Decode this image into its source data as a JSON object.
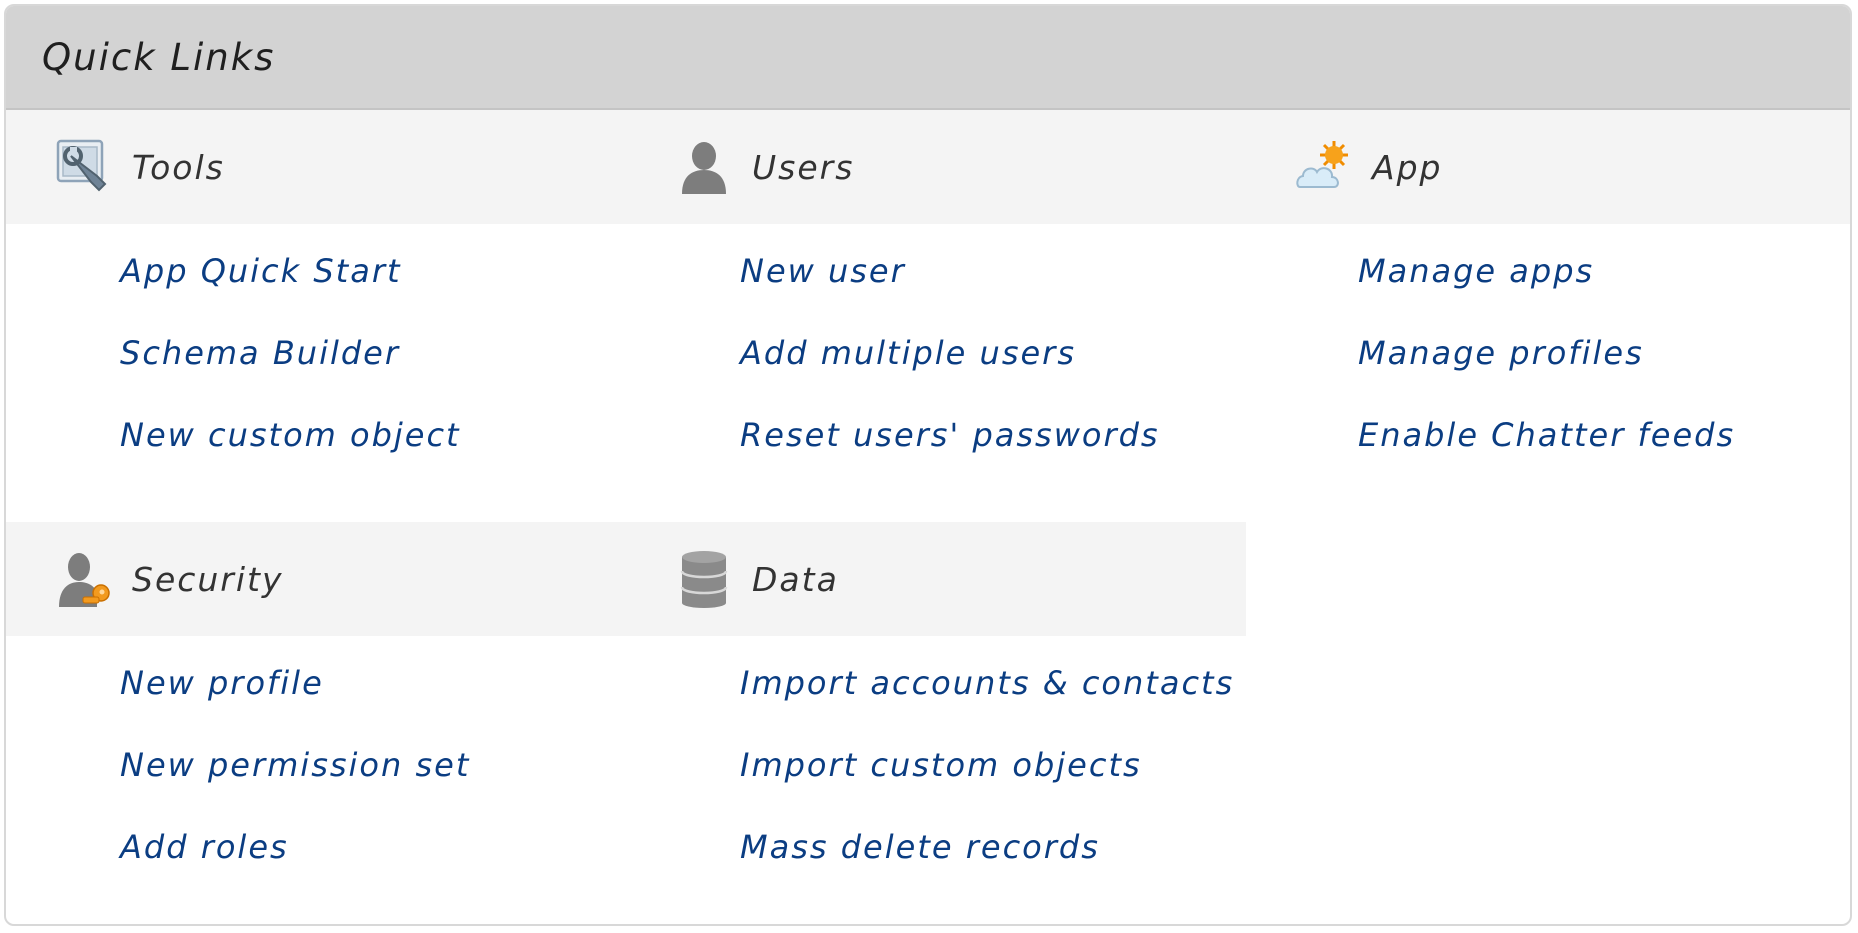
{
  "panel": {
    "title": "Quick Links"
  },
  "sections": {
    "tools": {
      "label": "Tools",
      "icon": "tools-icon",
      "links": [
        "App Quick Start",
        "Schema Builder",
        "New custom object"
      ]
    },
    "users": {
      "label": "Users",
      "icon": "user-icon",
      "links": [
        "New user",
        "Add multiple users",
        "Reset users' passwords"
      ]
    },
    "app": {
      "label": "App",
      "icon": "cloud-sun-icon",
      "links": [
        "Manage apps",
        "Manage profiles",
        "Enable Chatter feeds"
      ]
    },
    "security": {
      "label": "Security",
      "icon": "user-key-icon",
      "links": [
        "New profile",
        "New permission set",
        "Add roles"
      ]
    },
    "data": {
      "label": "Data",
      "icon": "database-icon",
      "links": [
        "Import accounts & contacts",
        "Import custom objects",
        "Mass delete records"
      ]
    }
  },
  "colors": {
    "header_bg": "#d3d3d3",
    "section_bg": "#f4f4f4",
    "link": "#0b3d82"
  }
}
